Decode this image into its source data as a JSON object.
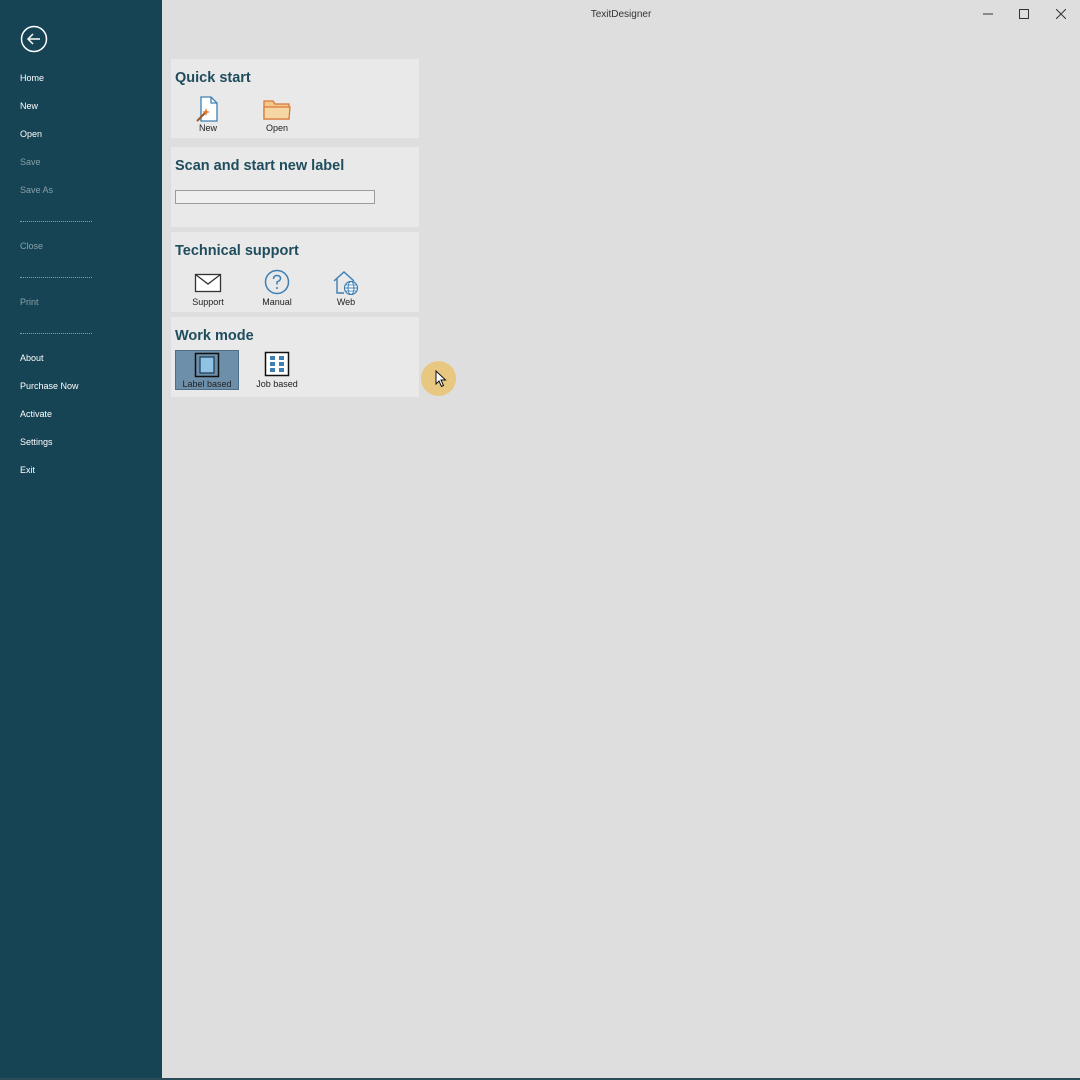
{
  "window": {
    "title": "TexitDesigner"
  },
  "sidebar": {
    "items": [
      {
        "label": "Home",
        "enabled": true
      },
      {
        "label": "New",
        "enabled": true
      },
      {
        "label": "Open",
        "enabled": true
      },
      {
        "label": "Save",
        "enabled": false
      },
      {
        "label": "Save As",
        "enabled": false
      },
      {
        "label": "Close",
        "enabled": false
      },
      {
        "label": "Print",
        "enabled": false
      },
      {
        "label": "About",
        "enabled": true
      },
      {
        "label": "Purchase Now",
        "enabled": true
      },
      {
        "label": "Activate",
        "enabled": true
      },
      {
        "label": "Settings",
        "enabled": true
      },
      {
        "label": "Exit",
        "enabled": true
      }
    ]
  },
  "quick_start": {
    "title": "Quick start",
    "new_label": "New",
    "open_label": "Open"
  },
  "scan": {
    "title": "Scan and start new label",
    "input_value": ""
  },
  "support": {
    "title": "Technical support",
    "support_label": "Support",
    "manual_label": "Manual",
    "web_label": "Web"
  },
  "work_mode": {
    "title": "Work mode",
    "label_based": "Label based",
    "job_based": "Job based",
    "selected": "Label based"
  },
  "colors": {
    "sidebar_bg": "#164454",
    "heading": "#1f4d5d",
    "selected_tile": "#6e8fa9",
    "cursor_halo": "#e8c780"
  },
  "icons": [
    "back-arrow-icon",
    "minimize-icon",
    "maximize-icon",
    "close-icon",
    "new-document-icon",
    "folder-icon",
    "mail-icon",
    "help-icon",
    "web-home-icon",
    "single-label-icon",
    "grid-labels-icon",
    "mouse-cursor-icon"
  ]
}
